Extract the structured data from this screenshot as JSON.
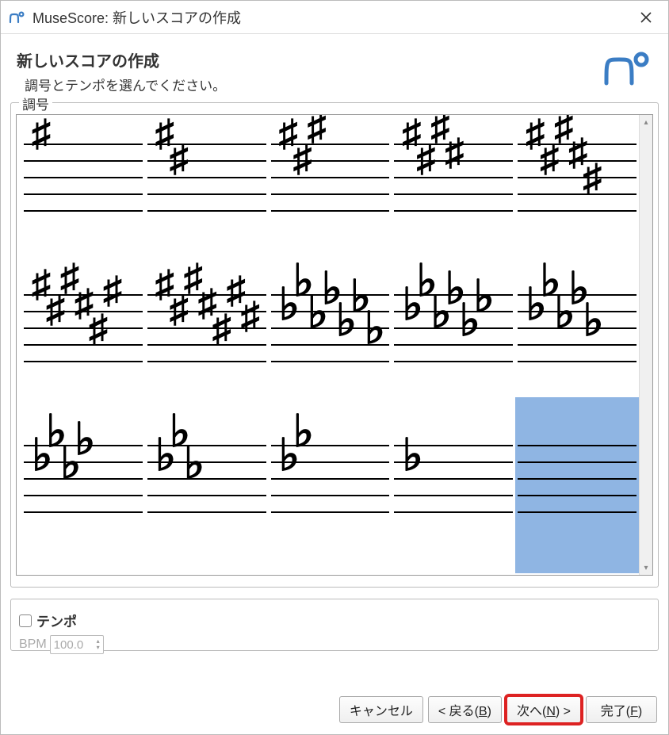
{
  "window": {
    "title": "MuseScore: 新しいスコアの作成"
  },
  "header": {
    "title": "新しいスコアの作成",
    "subtitle": "調号とテンポを選んでください。"
  },
  "keysig": {
    "group_label": "調号",
    "selected_index": 14,
    "cells": [
      {
        "type": "sharp",
        "count": 1
      },
      {
        "type": "sharp",
        "count": 2
      },
      {
        "type": "sharp",
        "count": 3
      },
      {
        "type": "sharp",
        "count": 4
      },
      {
        "type": "sharp",
        "count": 5
      },
      {
        "type": "sharp",
        "count": 6
      },
      {
        "type": "sharp",
        "count": 7
      },
      {
        "type": "flat",
        "count": 7
      },
      {
        "type": "flat",
        "count": 6
      },
      {
        "type": "flat",
        "count": 5
      },
      {
        "type": "flat",
        "count": 4
      },
      {
        "type": "flat",
        "count": 3
      },
      {
        "type": "flat",
        "count": 2
      },
      {
        "type": "flat",
        "count": 1
      },
      {
        "type": "none",
        "count": 0
      }
    ]
  },
  "tempo": {
    "label": "テンポ",
    "bpm_label": "BPM",
    "bpm_value": "100.0",
    "enabled": false
  },
  "footer": {
    "cancel": "キャンセル",
    "back_prefix": "< 戻る(",
    "back_u": "B",
    "back_suffix": ")",
    "next_prefix": "次へ(",
    "next_u": "N",
    "next_suffix": ") >",
    "finish_prefix": "完了(",
    "finish_u": "F",
    "finish_suffix": ")"
  }
}
